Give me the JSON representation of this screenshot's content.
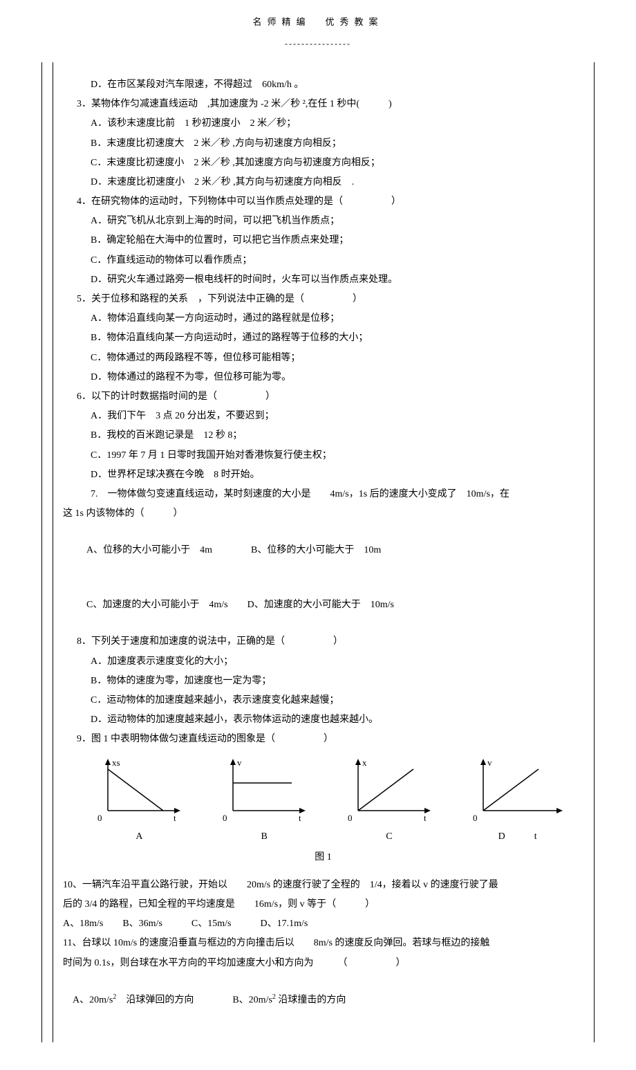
{
  "header": {
    "left": "名师精编",
    "right": "优秀教案"
  },
  "divider": "----------------",
  "q2": {
    "optD": "D．在市区某段对汽车限速，不得超过　60km/h 。"
  },
  "q3": {
    "stem": "3．某物体作匀减速直线运动　,其加速度为 -2 米／秒 ²,在任 1 秒中(　　　)",
    "optA": "A．该秒末速度比前　1 秒初速度小　2 米／秒；",
    "optB": "B．末速度比初速度大　2 米／秒 ,方向与初速度方向相反；",
    "optC": "C．末速度比初速度小　2 米／秒 ,其加速度方向与初速度方向相反；",
    "optD": "D．末速度比初速度小　2 米／秒 ,其方向与初速度方向相反　."
  },
  "q4": {
    "stem": "4．在研究物体的运动时，下列物体中可以当作质点处理的是（　　　　　）",
    "optA": "A．研究飞机从北京到上海的时间，可以把飞机当作质点；",
    "optB": "B．确定轮船在大海中的位置时，可以把它当作质点来处理；",
    "optC": "C．作直线运动的物体可以看作质点；",
    "optD": "D．研究火车通过路旁一根电线杆的时间时，火车可以当作质点来处理。"
  },
  "q5": {
    "stem": "5．关于位移和路程的关系　，下列说法中正确的是（　　　　　）",
    "optA": "A．物体沿直线向某一方向运动时，通过的路程就是位移；",
    "optB": "B．物体沿直线向某一方向运动时，通过的路程等于位移的大小；",
    "optC": "C．物体通过的两段路程不等，但位移可能相等；",
    "optD": "D．物体通过的路程不为零，但位移可能为零。"
  },
  "q6": {
    "stem": "6．以下的计时数据指时间的是（　　　　　）",
    "optA": "A．我们下午　3 点 20 分出发，不要迟到；",
    "optB": "B．我校的百米跑记录是　12 秒 8；",
    "optC": "C．1997 年 7 月 1 日零时我国开始对香港恢复行使主权；",
    "optD": "D．世界杯足球决赛在今晚　8 时开始。"
  },
  "q7": {
    "stem1": "7.　一物体做匀变速直线运动，某时刻速度的大小是　　4m/s，1s 后的速度大小变成了　10m/s，在",
    "stem2": "这 1s 内该物体的（　　　）",
    "optA": "A、位移的大小可能小于　4m",
    "optB": "B、位移的大小可能大于　10m",
    "optC": "C、加速度的大小可能小于　4m/s",
    "optD": "D、加速度的大小可能大于　10m/s"
  },
  "q8": {
    "stem": "8．下列关于速度和加速度的说法中，正确的是（　　　　　）",
    "optA": "A．加速度表示速度变化的大小；",
    "optB": "B．物体的速度为零，加速度也一定为零；",
    "optC": "C．运动物体的加速度越来越小，表示速度变化越来越慢；",
    "optD": "D．运动物体的加速度越来越小，表示物体运动的速度也越来越小。"
  },
  "q9": {
    "stem": "9．图 1 中表明物体做匀速直线运动的图象是（　　　　　）",
    "labels": {
      "A": "A",
      "B": "B",
      "C": "C",
      "D": "D"
    },
    "axes": {
      "A_y": "xs",
      "B_y": "v",
      "C_y": "x",
      "D_y": "v",
      "x": "t",
      "zero": "0"
    },
    "caption": "图 1"
  },
  "q10": {
    "line1": "10、一辆汽车沿平直公路行驶，开始以　　20m/s 的速度行驶了全程的　1/4，接着以 v 的速度行驶了最",
    "line2": "后的 3/4 的路程，已知全程的平均速度是　　16m/s，则 v 等于（　　　）",
    "opts": "A、18m/s　　B、36m/s　　　C、15m/s　　　D、17.1m/s"
  },
  "q11": {
    "line1": "11、台球以 10m/s 的速度沿垂直与框边的方向撞击后以　　8m/s 的速度反向弹回。若球与框边的接触",
    "line2": "时间为 0.1s，则台球在水平方向的平均加速度大小和方向为　　　（　　　　　）",
    "optA_prefix": "A、20m/s",
    "optA_suffix": "　沿球弹回的方向",
    "optB_prefix": "B、20m/s",
    "optB_suffix": " 沿球撞击的方向",
    "sup": "2"
  },
  "chart_data": [
    {
      "type": "line",
      "title": "A",
      "xlabel": "t",
      "ylabel": "xs",
      "description": "decreasing line from positive y-intercept to x-axis"
    },
    {
      "type": "line",
      "title": "B",
      "xlabel": "t",
      "ylabel": "v",
      "description": "horizontal line at constant positive v"
    },
    {
      "type": "line",
      "title": "C",
      "xlabel": "t",
      "ylabel": "x",
      "description": "increasing line through origin"
    },
    {
      "type": "line",
      "title": "D",
      "xlabel": "t",
      "ylabel": "v",
      "description": "increasing line through origin"
    }
  ]
}
